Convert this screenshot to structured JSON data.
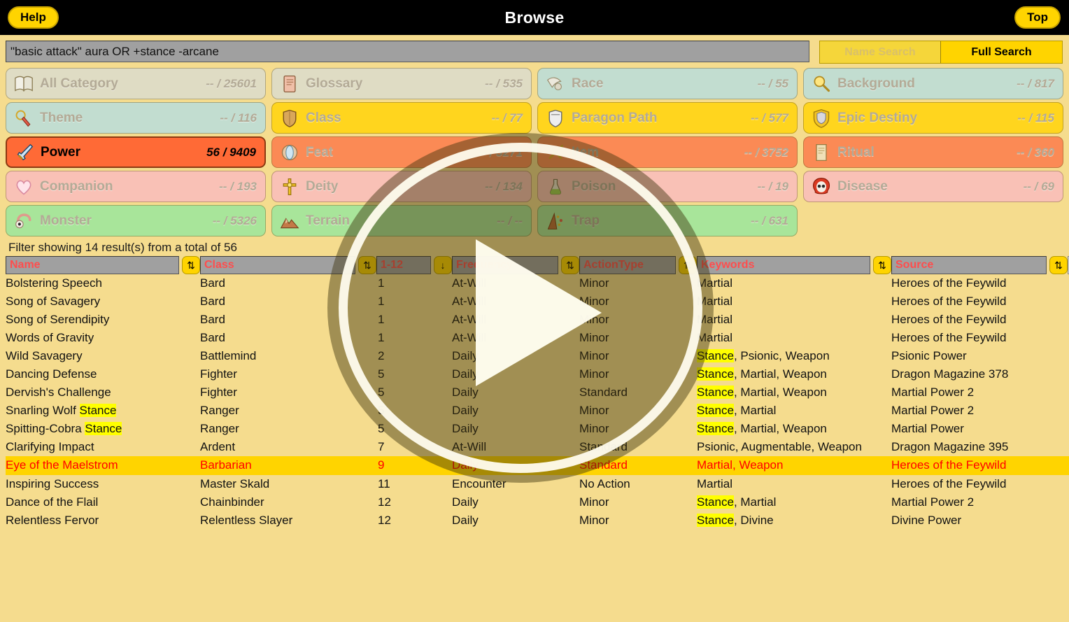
{
  "topbar": {
    "help_label": "Help",
    "title": "Browse",
    "top_label": "Top"
  },
  "search": {
    "query": "\"basic attack\" aura OR +stance -arcane",
    "placeholder": "",
    "name_search_label": "Name Search",
    "full_search_label": "Full Search",
    "active_mode": "Full Search"
  },
  "categories": [
    {
      "label": "All Category",
      "count": "-- / 25601",
      "icon": "book-icon",
      "theme": "r0",
      "selected": false
    },
    {
      "label": "Glossary",
      "count": "-- / 535",
      "icon": "scroll-book-icon",
      "theme": "r0",
      "selected": false
    },
    {
      "label": "Race",
      "count": "-- / 55",
      "icon": "wing-icon",
      "theme": "r1",
      "selected": false
    },
    {
      "label": "Background",
      "count": "-- / 817",
      "icon": "magnifier-icon",
      "theme": "r1",
      "selected": false
    },
    {
      "label": "Theme",
      "count": "-- / 116",
      "icon": "amulet-icon",
      "theme": "r1",
      "selected": false
    },
    {
      "label": "Class",
      "count": "-- / 77",
      "icon": "shield-icon",
      "theme": "r1y",
      "selected": false
    },
    {
      "label": "Paragon Path",
      "count": "-- / 577",
      "icon": "helm-shield-icon",
      "theme": "r1y",
      "selected": false
    },
    {
      "label": "Epic Destiny",
      "count": "-- / 115",
      "icon": "crest-icon",
      "theme": "r1y",
      "selected": false
    },
    {
      "label": "Power",
      "count": "56 / 9409",
      "icon": "sword-icon",
      "theme": "r2",
      "selected": true
    },
    {
      "label": "Feat",
      "count": "-- / 3271",
      "icon": "gem-icon",
      "theme": "r2",
      "selected": false
    },
    {
      "label": "Item",
      "count": "-- / 3752",
      "icon": "crossed-swords-icon",
      "theme": "r2",
      "selected": false
    },
    {
      "label": "Ritual",
      "count": "-- / 360",
      "icon": "parchment-icon",
      "theme": "r2",
      "selected": false
    },
    {
      "label": "Companion",
      "count": "-- / 193",
      "icon": "heart-icon",
      "theme": "r3",
      "selected": false
    },
    {
      "label": "Deity",
      "count": "-- / 134",
      "icon": "cross-icon",
      "theme": "r3",
      "selected": false
    },
    {
      "label": "Poison",
      "count": "-- / 19",
      "icon": "flask-icon",
      "theme": "r3",
      "selected": false
    },
    {
      "label": "Disease",
      "count": "-- / 69",
      "icon": "skull-icon",
      "theme": "r3",
      "selected": false
    },
    {
      "label": "Monster",
      "count": "-- / 5326",
      "icon": "eye-tail-icon",
      "theme": "r4",
      "selected": false
    },
    {
      "label": "Terrain",
      "count": "-- / --",
      "icon": "mountain-icon",
      "theme": "r4",
      "selected": false
    },
    {
      "label": "Trap",
      "count": "-- / 631",
      "icon": "trap-icon",
      "theme": "r4",
      "selected": false
    }
  ],
  "filter_status": "Filter showing 14 result(s) from a total of 56",
  "table": {
    "columns": [
      {
        "key": "name",
        "filter_value": "Name",
        "sort_icon": "sort-updown-icon"
      },
      {
        "key": "class",
        "filter_value": "Class",
        "sort_icon": "sort-updown-icon"
      },
      {
        "key": "level",
        "filter_value": "1-12",
        "sort_icon": "sort-down-icon"
      },
      {
        "key": "frequency",
        "filter_value": "Frequency",
        "sort_icon": "sort-updown-icon"
      },
      {
        "key": "actiontype",
        "filter_value": "ActionType",
        "sort_icon": "sort-updown-icon"
      },
      {
        "key": "keywords",
        "filter_value": "Keywords",
        "sort_icon": "sort-updown-icon"
      },
      {
        "key": "source",
        "filter_value": "Source",
        "sort_icon": "sort-updown-icon"
      }
    ],
    "close_label": "×",
    "rows": [
      {
        "name": "Bolstering Speech",
        "class": "Bard",
        "level": "1",
        "frequency": "At-Will",
        "actiontype": "Minor",
        "keywords": "Martial",
        "source": "Heroes of the Feywild",
        "highlighted": false,
        "hl_terms": []
      },
      {
        "name": "Song of Savagery",
        "class": "Bard",
        "level": "1",
        "frequency": "At-Will",
        "actiontype": "Minor",
        "keywords": "Martial",
        "source": "Heroes of the Feywild",
        "highlighted": false,
        "hl_terms": []
      },
      {
        "name": "Song of Serendipity",
        "class": "Bard",
        "level": "1",
        "frequency": "At-Will",
        "actiontype": "Minor",
        "keywords": "Martial",
        "source": "Heroes of the Feywild",
        "highlighted": false,
        "hl_terms": []
      },
      {
        "name": "Words of Gravity",
        "class": "Bard",
        "level": "1",
        "frequency": "At-Will",
        "actiontype": "Minor",
        "keywords": "Martial",
        "source": "Heroes of the Feywild",
        "highlighted": false,
        "hl_terms": []
      },
      {
        "name": "Wild Savagery",
        "class": "Battlemind",
        "level": "2",
        "frequency": "Daily",
        "actiontype": "Minor",
        "keywords": "Stance, Psionic, Weapon",
        "source": "Psionic Power",
        "highlighted": false,
        "hl_terms": [
          "Stance"
        ]
      },
      {
        "name": "Dancing Defense",
        "class": "Fighter",
        "level": "5",
        "frequency": "Daily",
        "actiontype": "Minor",
        "keywords": "Stance, Martial, Weapon",
        "source": "Dragon Magazine 378",
        "highlighted": false,
        "hl_terms": [
          "Stance"
        ]
      },
      {
        "name": "Dervish's Challenge",
        "class": "Fighter",
        "level": "5",
        "frequency": "Daily",
        "actiontype": "Standard",
        "keywords": "Stance, Martial, Weapon",
        "source": "Martial Power 2",
        "highlighted": false,
        "hl_terms": [
          "Stance"
        ]
      },
      {
        "name": "Snarling Wolf Stance",
        "class": "Ranger",
        "level": "5",
        "frequency": "Daily",
        "actiontype": "Minor",
        "keywords": "Stance, Martial",
        "source": "Martial Power 2",
        "highlighted": false,
        "hl_terms": [
          "Stance"
        ]
      },
      {
        "name": "Spitting-Cobra Stance",
        "class": "Ranger",
        "level": "5",
        "frequency": "Daily",
        "actiontype": "Minor",
        "keywords": "Stance, Martial, Weapon",
        "source": "Martial Power",
        "highlighted": false,
        "hl_terms": [
          "Stance"
        ]
      },
      {
        "name": "Clarifying Impact",
        "class": "Ardent",
        "level": "7",
        "frequency": "At-Will",
        "actiontype": "Standard",
        "keywords": "Psionic, Augmentable, Weapon",
        "source": "Dragon Magazine 395",
        "highlighted": false,
        "hl_terms": []
      },
      {
        "name": "Eye of the Maelstrom",
        "class": "Barbarian",
        "level": "9",
        "frequency": "Daily",
        "actiontype": "Standard",
        "keywords": "Martial, Weapon",
        "source": "Heroes of the Feywild",
        "highlighted": true,
        "hl_terms": []
      },
      {
        "name": "Inspiring Success",
        "class": "Master Skald",
        "level": "11",
        "frequency": "Encounter",
        "actiontype": "No Action",
        "keywords": "Martial",
        "source": "Heroes of the Feywild",
        "highlighted": false,
        "hl_terms": []
      },
      {
        "name": "Dance of the Flail",
        "class": "Chainbinder",
        "level": "12",
        "frequency": "Daily",
        "actiontype": "Minor",
        "keywords": "Stance, Martial",
        "source": "Martial Power 2",
        "highlighted": false,
        "hl_terms": [
          "Stance"
        ]
      },
      {
        "name": "Relentless Fervor",
        "class": "Relentless Slayer",
        "level": "12",
        "frequency": "Daily",
        "actiontype": "Minor",
        "keywords": "Stance, Divine",
        "source": "Divine Power",
        "highlighted": false,
        "hl_terms": [
          "Stance"
        ]
      }
    ]
  },
  "overlay": {
    "play_icon": "play-button-icon"
  },
  "colors": {
    "page_background": "#f5dc8e",
    "topbar": "#000000",
    "accent_yellow": "#ffd400",
    "selected_tile": "#ff6a36",
    "highlight_row": "#ffd400",
    "highlight_text": "#ff0000",
    "search_term_highlight": "#ffff00",
    "header_filter_text": "#ff4d4d"
  }
}
